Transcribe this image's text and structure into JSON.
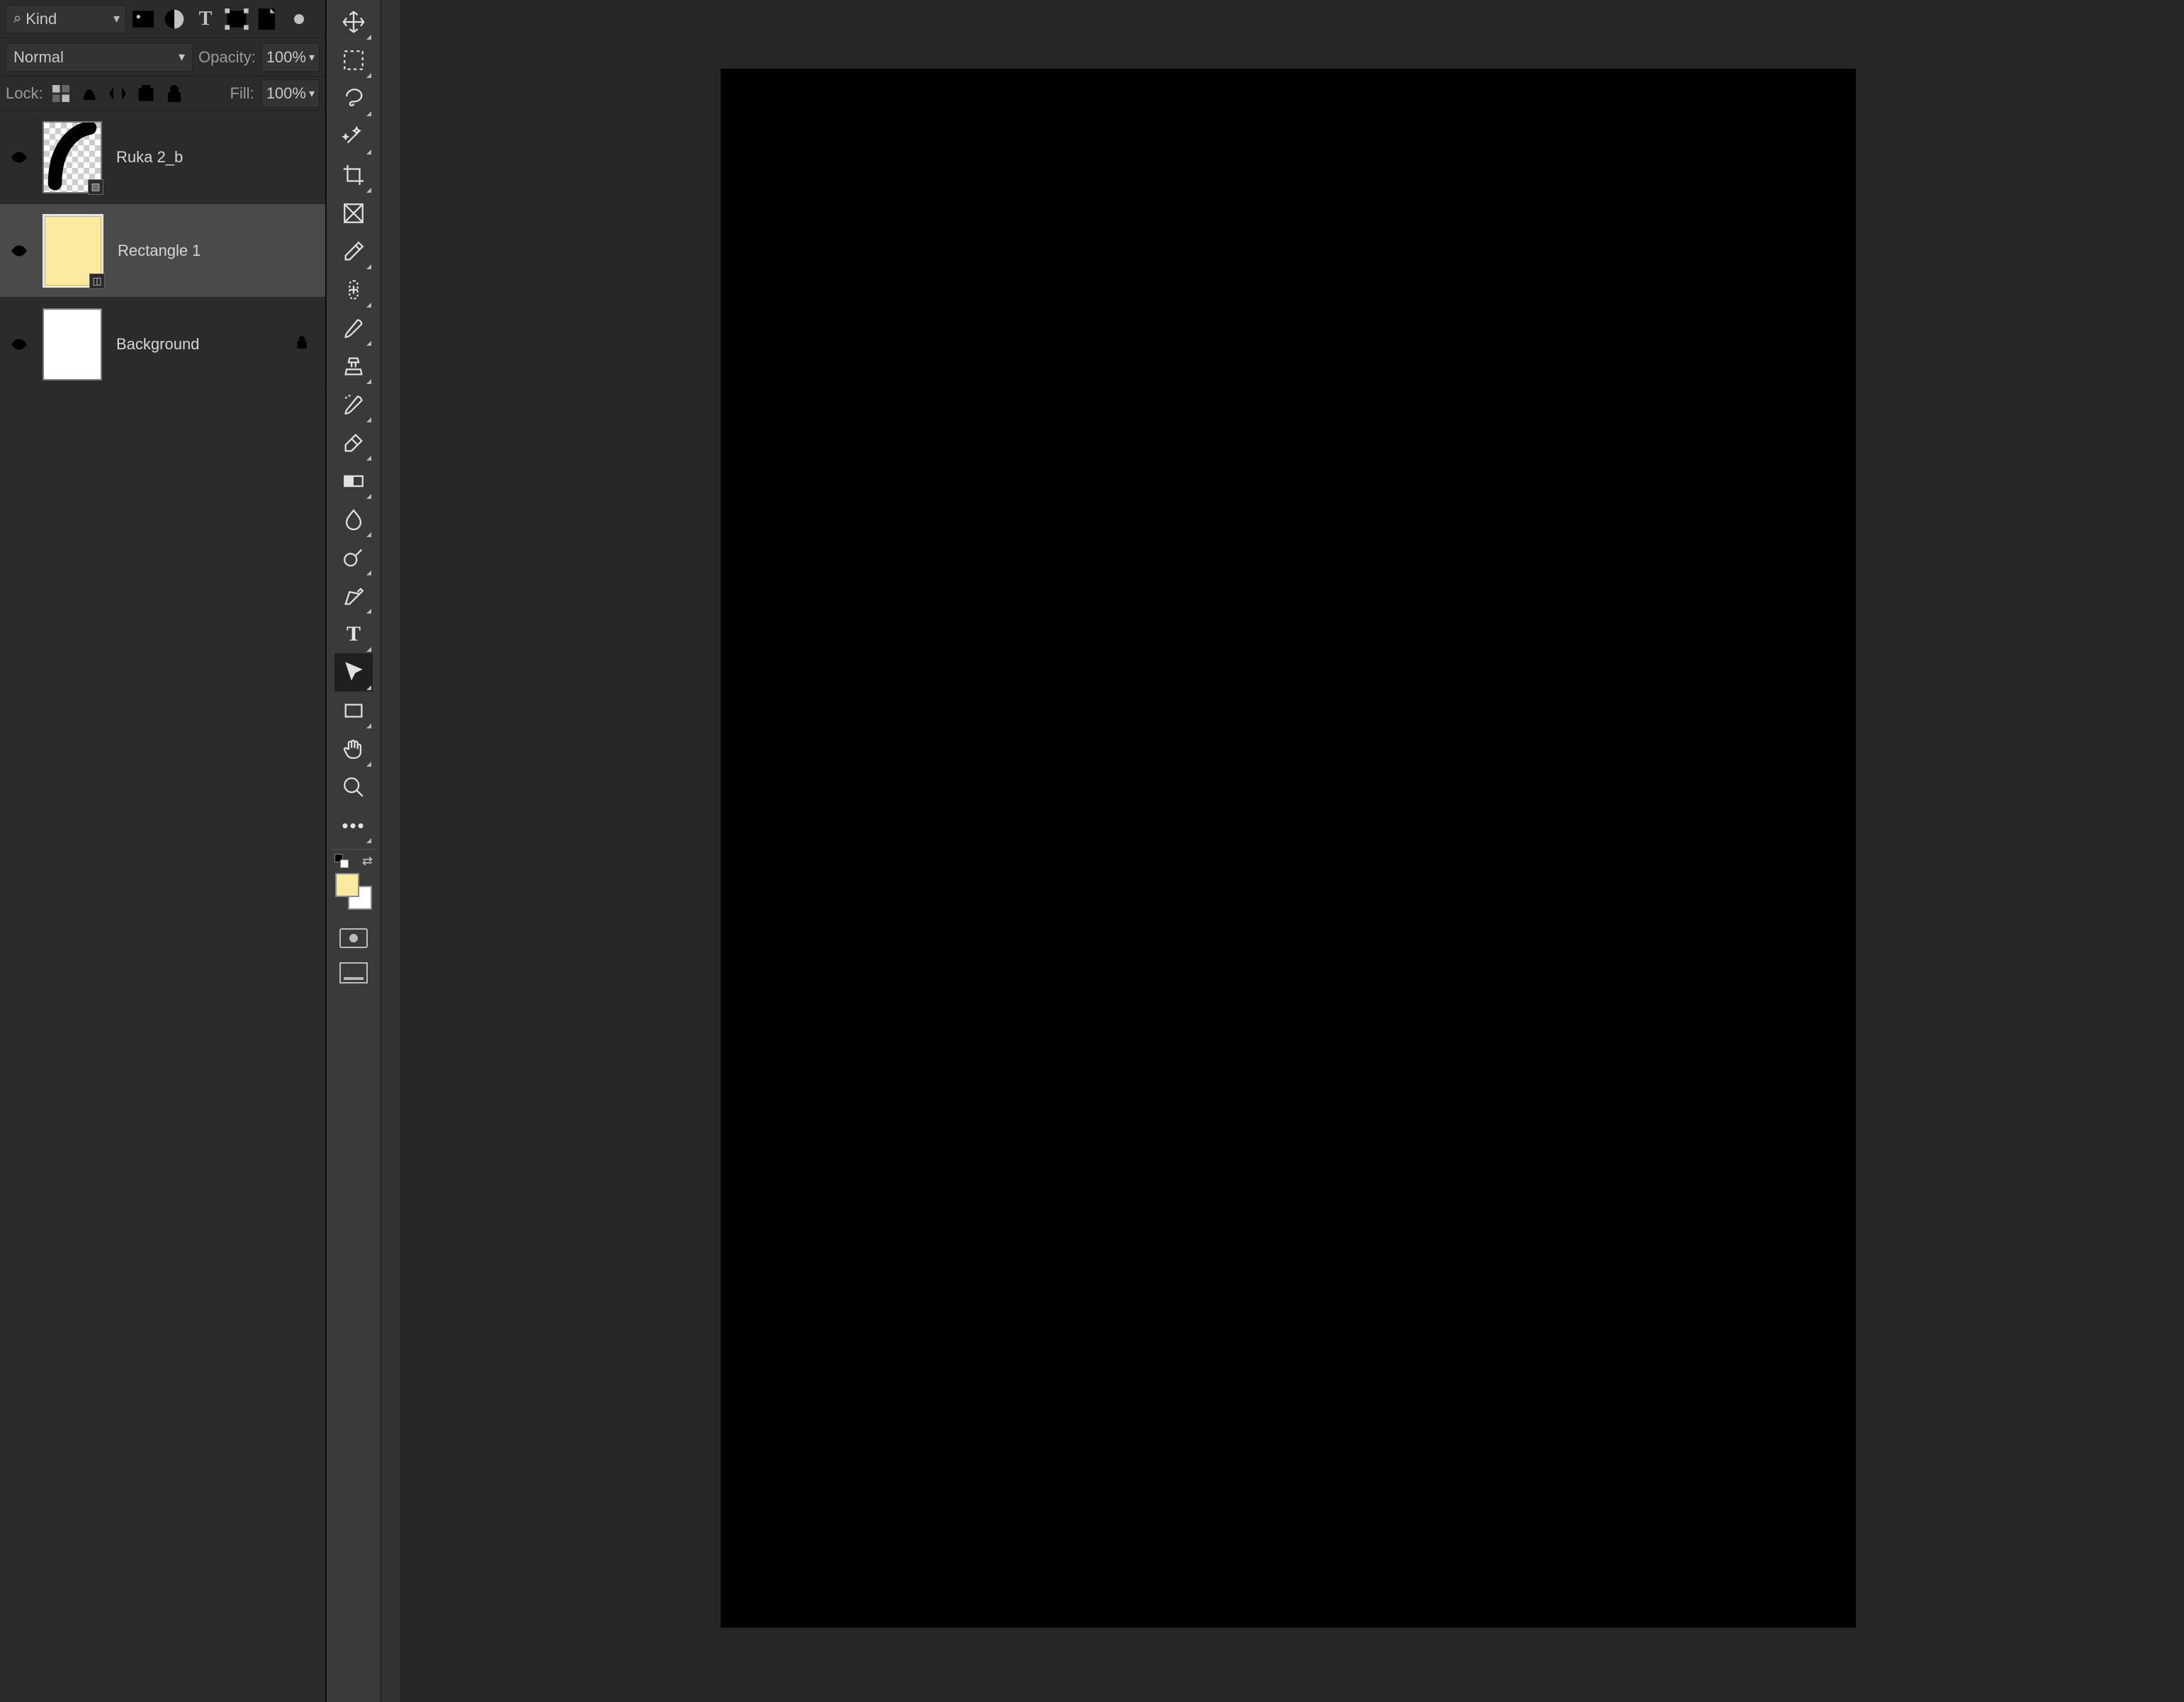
{
  "layers_panel": {
    "filter_kind": "Kind",
    "blend_mode": "Normal",
    "opacity_label": "Opacity:",
    "opacity_value": "100%",
    "lock_label": "Lock:",
    "fill_label": "Fill:",
    "fill_value": "100%",
    "layers": [
      {
        "name": "Ruka 2_b",
        "locked": false,
        "selected": false,
        "thumb": "stroke"
      },
      {
        "name": "Rectangle 1",
        "locked": false,
        "selected": true,
        "thumb": "yellow"
      },
      {
        "name": "Background",
        "locked": true,
        "selected": false,
        "thumb": "white"
      }
    ]
  },
  "toolbar": {
    "tools": [
      {
        "id": "move"
      },
      {
        "id": "marquee"
      },
      {
        "id": "lasso"
      },
      {
        "id": "magic-wand"
      },
      {
        "id": "crop"
      },
      {
        "id": "frame"
      },
      {
        "id": "eyedropper"
      },
      {
        "id": "healing-brush"
      },
      {
        "id": "brush"
      },
      {
        "id": "clone-stamp"
      },
      {
        "id": "history-brush"
      },
      {
        "id": "eraser"
      },
      {
        "id": "gradient"
      },
      {
        "id": "blur"
      },
      {
        "id": "dodge"
      },
      {
        "id": "pen"
      },
      {
        "id": "type"
      },
      {
        "id": "path-selection",
        "selected": true
      },
      {
        "id": "rectangle-shape"
      },
      {
        "id": "hand"
      },
      {
        "id": "zoom"
      },
      {
        "id": "more"
      }
    ],
    "foreground_color": "#fbea9f",
    "background_color": "#ffffff"
  },
  "canvas": {
    "fill": "#000000"
  }
}
